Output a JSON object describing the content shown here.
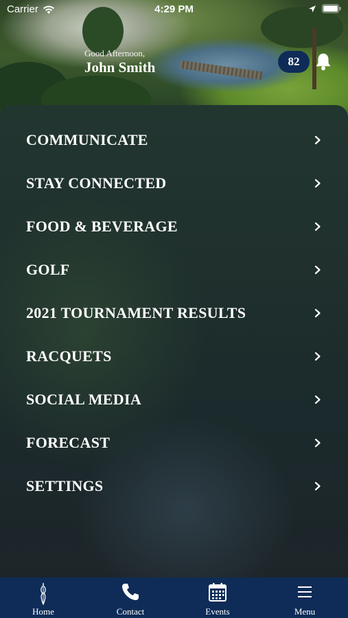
{
  "status_bar": {
    "carrier": "Carrier",
    "time": "4:29 PM"
  },
  "header": {
    "greeting": "Good Afternoon,",
    "name": "John Smith",
    "temperature": "82"
  },
  "menu": {
    "items": [
      {
        "label": "COMMUNICATE"
      },
      {
        "label": "STAY CONNECTED"
      },
      {
        "label": "FOOD & BEVERAGE"
      },
      {
        "label": "GOLF"
      },
      {
        "label": "2021 TOURNAMENT RESULTS"
      },
      {
        "label": "RACQUETS"
      },
      {
        "label": "SOCIAL MEDIA"
      },
      {
        "label": "FORECAST"
      },
      {
        "label": "SETTINGS"
      }
    ]
  },
  "tabbar": {
    "items": [
      {
        "label": "Home",
        "icon": "club-logo-icon"
      },
      {
        "label": "Contact",
        "icon": "phone-icon"
      },
      {
        "label": "Events",
        "icon": "calendar-icon"
      },
      {
        "label": "Menu",
        "icon": "hamburger-icon"
      }
    ]
  },
  "colors": {
    "navy": "#0e2c57",
    "panel": "#1f302d"
  }
}
